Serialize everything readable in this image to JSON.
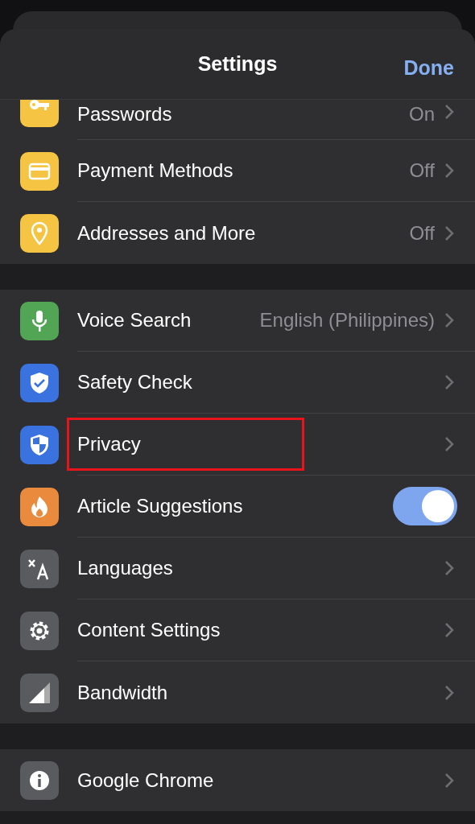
{
  "header": {
    "title": "Settings",
    "done": "Done"
  },
  "groups": [
    {
      "items": [
        {
          "label": "Passwords",
          "value": "On",
          "kind": "link",
          "color": "#f4c442",
          "highlighted": false
        },
        {
          "label": "Payment Methods",
          "value": "Off",
          "kind": "link",
          "color": "#f4c442",
          "highlighted": false
        },
        {
          "label": "Addresses and More",
          "value": "Off",
          "kind": "link",
          "color": "#f4c442",
          "highlighted": false
        }
      ]
    },
    {
      "items": [
        {
          "label": "Voice Search",
          "value": "English (Philippines)",
          "kind": "link",
          "color": "#53a556",
          "highlighted": false
        },
        {
          "label": "Safety Check",
          "kind": "link",
          "color": "#3a72e0",
          "highlighted": false
        },
        {
          "label": "Privacy",
          "kind": "link",
          "color": "#3a72e0",
          "highlighted": true
        },
        {
          "label": "Article Suggestions",
          "kind": "toggle",
          "on": true,
          "color": "#ea8a3c",
          "highlighted": false
        },
        {
          "label": "Languages",
          "kind": "link",
          "color": "#5a5b5f",
          "highlighted": false
        },
        {
          "label": "Content Settings",
          "kind": "link",
          "color": "#5a5b5f",
          "highlighted": false
        },
        {
          "label": "Bandwidth",
          "kind": "link",
          "color": "#5a5b5f",
          "highlighted": false
        }
      ]
    },
    {
      "items": [
        {
          "label": "Google Chrome",
          "kind": "link",
          "color": "#5a5b5f",
          "highlighted": false
        }
      ]
    }
  ]
}
